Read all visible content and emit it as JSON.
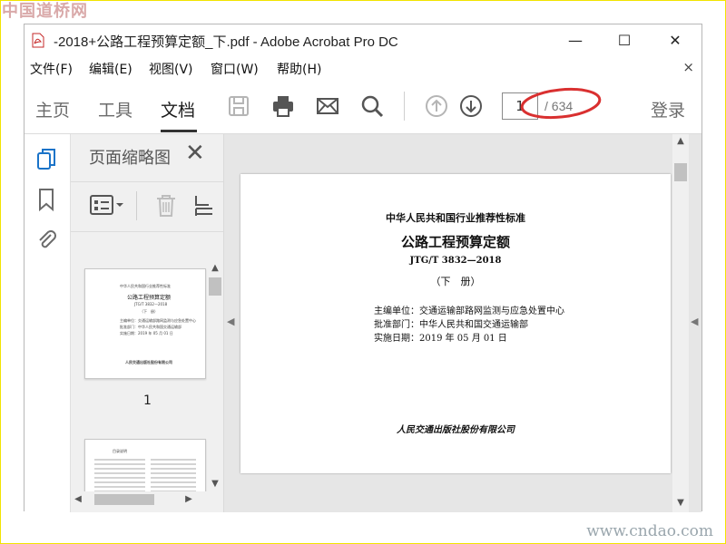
{
  "watermarks": {
    "top_left": "中国道桥网",
    "bottom_right": "www.cndao.com"
  },
  "window": {
    "title": "-2018+公路工程预算定额_下.pdf - Adobe Acrobat Pro DC",
    "controls": {
      "minimize": "—",
      "maximize": "☐",
      "close": "✕"
    }
  },
  "menu": {
    "items": [
      "文件(F)",
      "编辑(E)",
      "视图(V)",
      "窗口(W)",
      "帮助(H)"
    ],
    "close": "×"
  },
  "toolbar": {
    "tabs": [
      "主页",
      "工具",
      "文档"
    ],
    "active_tab": "文档",
    "page_current": "1",
    "page_total": "/ 634",
    "login": "登录",
    "icons": [
      "save-icon",
      "print-icon",
      "email-icon",
      "search-icon",
      "page-up-icon",
      "page-down-icon"
    ]
  },
  "thumbnails_panel": {
    "title": "页面缩略图",
    "close": "✕",
    "thumb1_number": "1"
  },
  "document": {
    "line1": "中华人民共和国行业推荐性标准",
    "line2": "公路工程预算定额",
    "line3": "JTG/T 3832—2018",
    "line4": "（下　册）",
    "line5": "主编单位：交通运输部路网监测与应急处置中心",
    "line6": "批准部门：中华人民共和国交通运输部",
    "line7": "实施日期：2019 年 05 月 01 日",
    "publisher": "人民交通出版社股份有限公司"
  },
  "thumb_text": {
    "t1": "中华人民共和国行业推荐性标准",
    "t2": "公路工程预算定额",
    "t3": "JTG/T 3832—2018",
    "t4": "（下　册）",
    "t5": "主编单位：交通运输部路网监测与应急处置中心",
    "t6": "批准部门：中华人民共和国交通运输部",
    "t7": "实施日期：2019 年 05 月 01 日",
    "t8": "人民交通出版社股份有限公司",
    "p2head": "目录说明"
  },
  "colors": {
    "highlight": "#d93030",
    "accent": "#1a73c8",
    "border": "#f2e400"
  }
}
